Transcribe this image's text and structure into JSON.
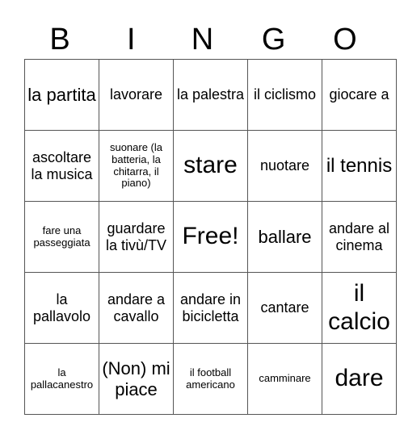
{
  "header": {
    "letters": [
      "B",
      "I",
      "N",
      "G",
      "O"
    ]
  },
  "rows": [
    [
      "la partita",
      "lavorare",
      "la palestra",
      "il ciclismo",
      "giocare a"
    ],
    [
      "ascoltare la musica",
      "suonare (la batteria, la chitarra, il piano)",
      "stare",
      "nuotare",
      "il tennis"
    ],
    [
      "fare una passeggiata",
      "guardare la tivù/TV",
      "Free!",
      "ballare",
      "andare al cinema"
    ],
    [
      "la pallavolo",
      "andare a cavallo",
      "andare in bicicletta",
      "cantare",
      "il calcio"
    ],
    [
      "la pallacanestro",
      "(Non) mi piace",
      "il football americano",
      "camminare",
      "dare"
    ]
  ]
}
